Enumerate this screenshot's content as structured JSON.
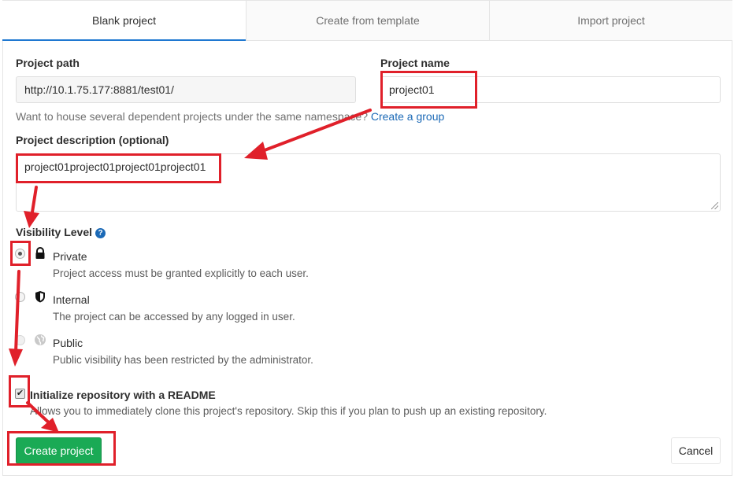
{
  "tabs": [
    {
      "label": "Blank project",
      "active": true
    },
    {
      "label": "Create from template",
      "active": false
    },
    {
      "label": "Import project",
      "active": false
    }
  ],
  "form": {
    "project_path_label": "Project path",
    "project_path_value": "http://10.1.75.177:8881/test01/",
    "project_name_label": "Project name",
    "project_name_value": "project01",
    "namespace_help": "Want to house several dependent projects under the same namespace?",
    "create_group_link": "Create a group",
    "description_label": "Project description (optional)",
    "description_value": "project01project01project01project01",
    "visibility_label": "Visibility Level",
    "visibility_help_icon": "?",
    "visibility": [
      {
        "name": "Private",
        "description": "Project access must be granted explicitly to each user.",
        "icon": "lock-icon",
        "selected": true
      },
      {
        "name": "Internal",
        "description": "The project can be accessed by any logged in user.",
        "icon": "shield-icon",
        "selected": false
      },
      {
        "name": "Public",
        "description": "Public visibility has been restricted by the administrator.",
        "icon": "globe-icon",
        "selected": false
      }
    ],
    "readme_label": "Initialize repository with a README",
    "readme_checked": true,
    "readme_description": "Allows you to immediately clone this project's repository. Skip this if you plan to push up an existing repository.",
    "checkmark": "✔"
  },
  "actions": {
    "create_label": "Create project",
    "cancel_label": "Cancel"
  },
  "colors": {
    "primary_green": "#1aaa55",
    "link_blue": "#1b69b6",
    "annotation_red": "#e0202a"
  }
}
